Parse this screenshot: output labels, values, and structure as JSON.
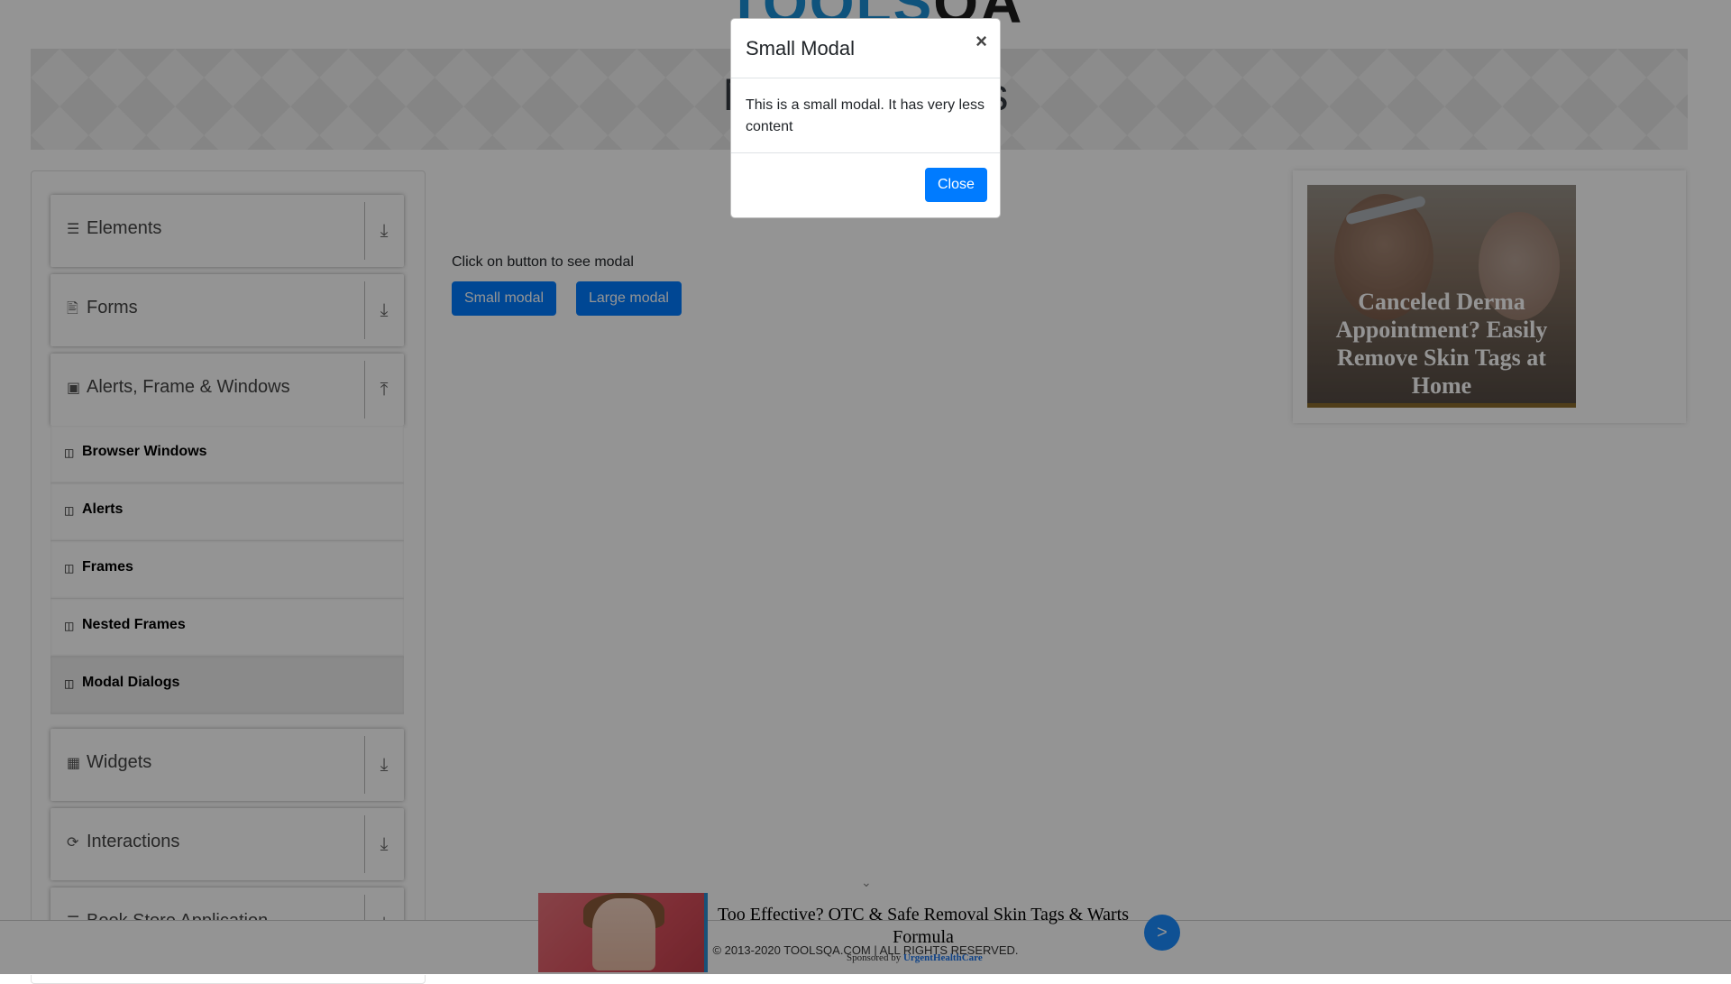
{
  "header": {
    "logo_tools": "TOOLS",
    "logo_qa": "QA",
    "page_title": "Modal Dialogs"
  },
  "sidebar": {
    "groups": [
      {
        "label": "Elements",
        "icon": "hamburger-icon",
        "arrow": "download-arrow-icon"
      },
      {
        "label": "Forms",
        "icon": "document-icon",
        "arrow": "download-arrow-icon"
      },
      {
        "label": "Alerts, Frame & Windows",
        "icon": "window-icon",
        "arrow": "upload-arrow-icon"
      },
      {
        "label": "Widgets",
        "icon": "grid-icon",
        "arrow": "download-arrow-icon"
      },
      {
        "label": "Interactions",
        "icon": "refresh-icon",
        "arrow": "download-arrow-icon"
      },
      {
        "label": "Book Store Application",
        "icon": "book-icon",
        "arrow": "download-arrow-icon"
      }
    ],
    "alerts_items": [
      {
        "label": "Browser Windows",
        "active": false
      },
      {
        "label": "Alerts",
        "active": false
      },
      {
        "label": "Frames",
        "active": false
      },
      {
        "label": "Nested Frames",
        "active": false
      },
      {
        "label": "Modal Dialogs",
        "active": true
      }
    ]
  },
  "main": {
    "instruction": "Click on button to see modal",
    "small_modal_button": "Small modal",
    "large_modal_button": "Large modal"
  },
  "right_ad": {
    "headline": "Canceled Derma Appointment? Easily Remove Skin Tags at Home"
  },
  "bottom_ad": {
    "headline": "Too Effective? OTC & Safe Removal Skin Tags & Warts Formula",
    "sponsored_prefix": "Sponsored by",
    "sponsor_name": "UrgentHealthCare",
    "go_label": ">"
  },
  "footer": {
    "copyright": "© 2013-2020 TOOLSQA.COM | ALL RIGHTS RESERVED."
  },
  "modal": {
    "title": "Small Modal",
    "close_symbol": "×",
    "body": "This is a small modal. It has very less content",
    "close_button": "Close"
  },
  "colors": {
    "primary": "#007bff",
    "backdrop": "rgba(0,0,0,0.42)",
    "logo_blue": "#1a8fd6"
  }
}
